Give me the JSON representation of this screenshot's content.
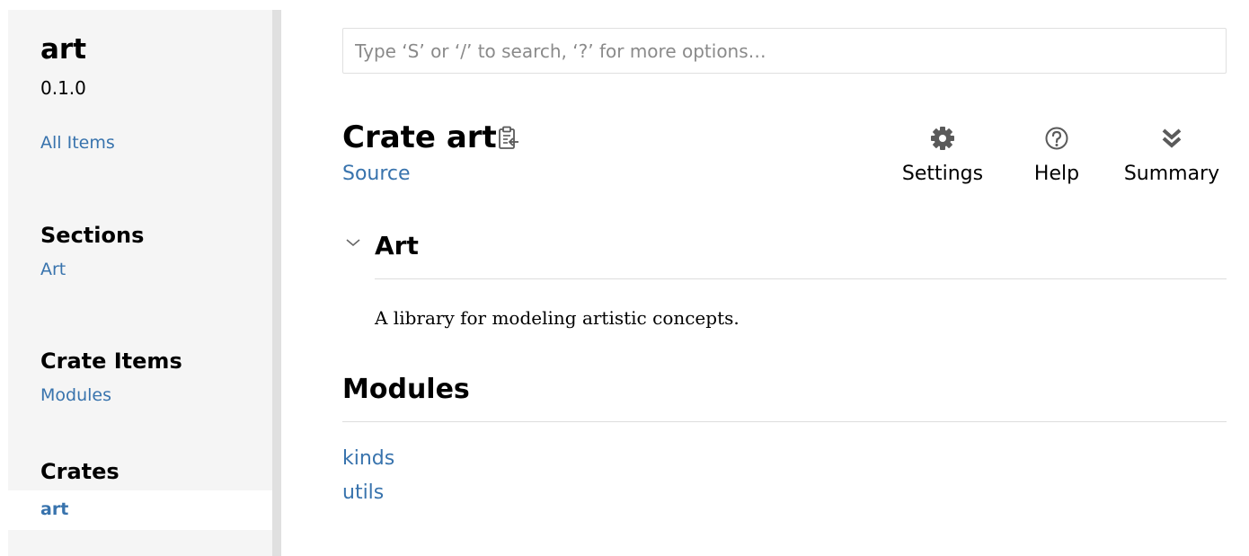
{
  "sidebar": {
    "crate_name": "art",
    "version": "0.1.0",
    "all_items": "All Items",
    "sections_heading": "Sections",
    "sections": [
      "Art"
    ],
    "crate_items_heading": "Crate Items",
    "crate_items": [
      "Modules"
    ],
    "crates_heading": "Crates",
    "crates": [
      "art"
    ]
  },
  "search": {
    "placeholder": "Type ‘S’ or ‘/’ to search, ‘?’ for more options…"
  },
  "main": {
    "title": "Crate art",
    "source_label": "Source",
    "toolbar": {
      "settings_label": "Settings",
      "help_label": "Help",
      "summary_label": "Summary"
    },
    "section_heading": "Art",
    "description": "A library for modeling artistic concepts.",
    "modules_heading": "Modules",
    "modules": [
      "kinds",
      "utils"
    ]
  },
  "colors": {
    "link": "#3873ad",
    "sidebar_bg": "#f5f5f5",
    "icon": "#5a5a5a"
  }
}
